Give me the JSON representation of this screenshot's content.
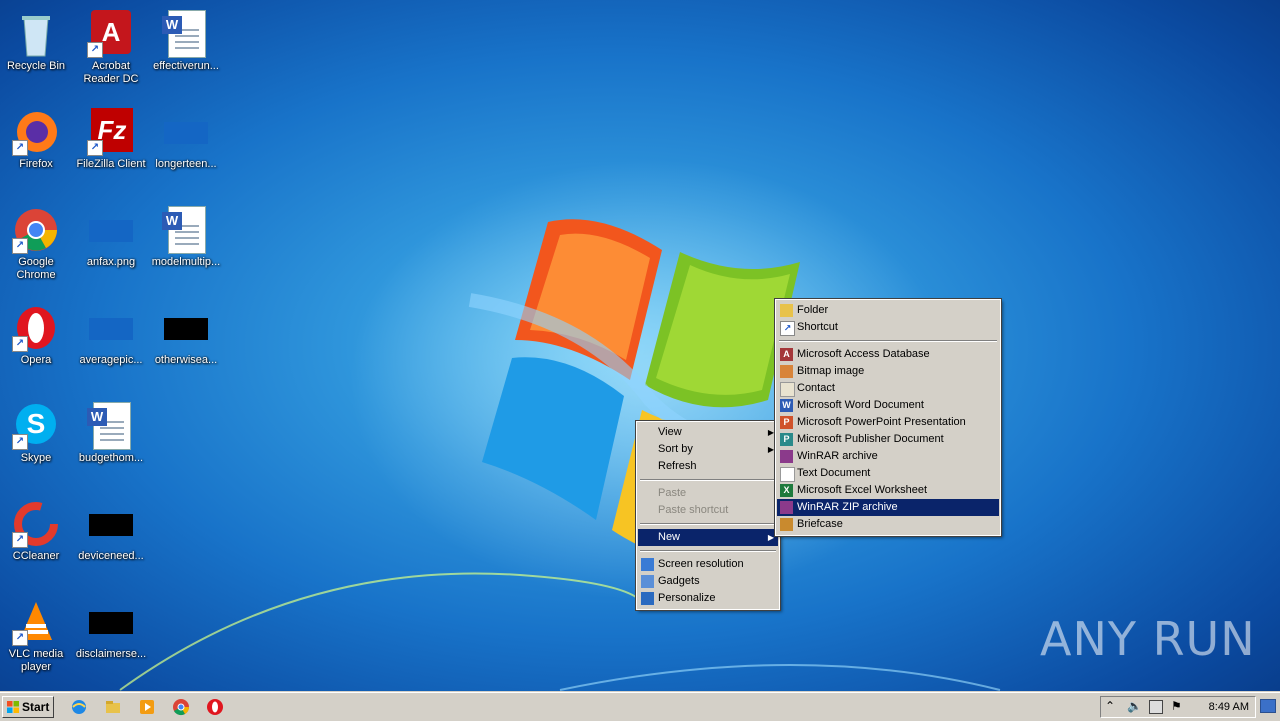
{
  "desktop": {
    "icons": [
      {
        "label": "Recycle Bin"
      },
      {
        "label": "Acrobat Reader DC"
      },
      {
        "label": "effectiverun..."
      },
      {
        "label": "Firefox"
      },
      {
        "label": "FileZilla Client"
      },
      {
        "label": "longerteen..."
      },
      {
        "label": "Google Chrome"
      },
      {
        "label": "anfax.png"
      },
      {
        "label": "modelmultip..."
      },
      {
        "label": "Opera"
      },
      {
        "label": "averagepic..."
      },
      {
        "label": "otherwisea..."
      },
      {
        "label": "Skype"
      },
      {
        "label": "budgethom..."
      },
      {
        "label": "CCleaner"
      },
      {
        "label": "deviceneed..."
      },
      {
        "label": "VLC media player"
      },
      {
        "label": "disclaimerse..."
      }
    ]
  },
  "context_menu": {
    "items": [
      {
        "label": "View"
      },
      {
        "label": "Sort by"
      },
      {
        "label": "Refresh"
      },
      {
        "label": "Paste"
      },
      {
        "label": "Paste shortcut"
      },
      {
        "label": "New"
      },
      {
        "label": "Screen resolution"
      },
      {
        "label": "Gadgets"
      },
      {
        "label": "Personalize"
      }
    ]
  },
  "new_submenu": {
    "items": [
      {
        "label": "Folder"
      },
      {
        "label": "Shortcut"
      },
      {
        "label": "Microsoft Access Database"
      },
      {
        "label": "Bitmap image"
      },
      {
        "label": "Contact"
      },
      {
        "label": "Microsoft Word Document"
      },
      {
        "label": "Microsoft PowerPoint Presentation"
      },
      {
        "label": "Microsoft Publisher Document"
      },
      {
        "label": "WinRAR archive"
      },
      {
        "label": "Text Document"
      },
      {
        "label": "Microsoft Excel Worksheet"
      },
      {
        "label": "WinRAR ZIP archive"
      },
      {
        "label": "Briefcase"
      }
    ],
    "selected": "WinRAR ZIP archive"
  },
  "taskbar": {
    "start_label": "Start",
    "clock": "8:49 AM"
  },
  "watermark": {
    "text": "ANY RUN"
  },
  "colors": {
    "menu_bg": "#d4d0c8",
    "highlight": "#0a246a",
    "desktop": "#1873c9"
  }
}
